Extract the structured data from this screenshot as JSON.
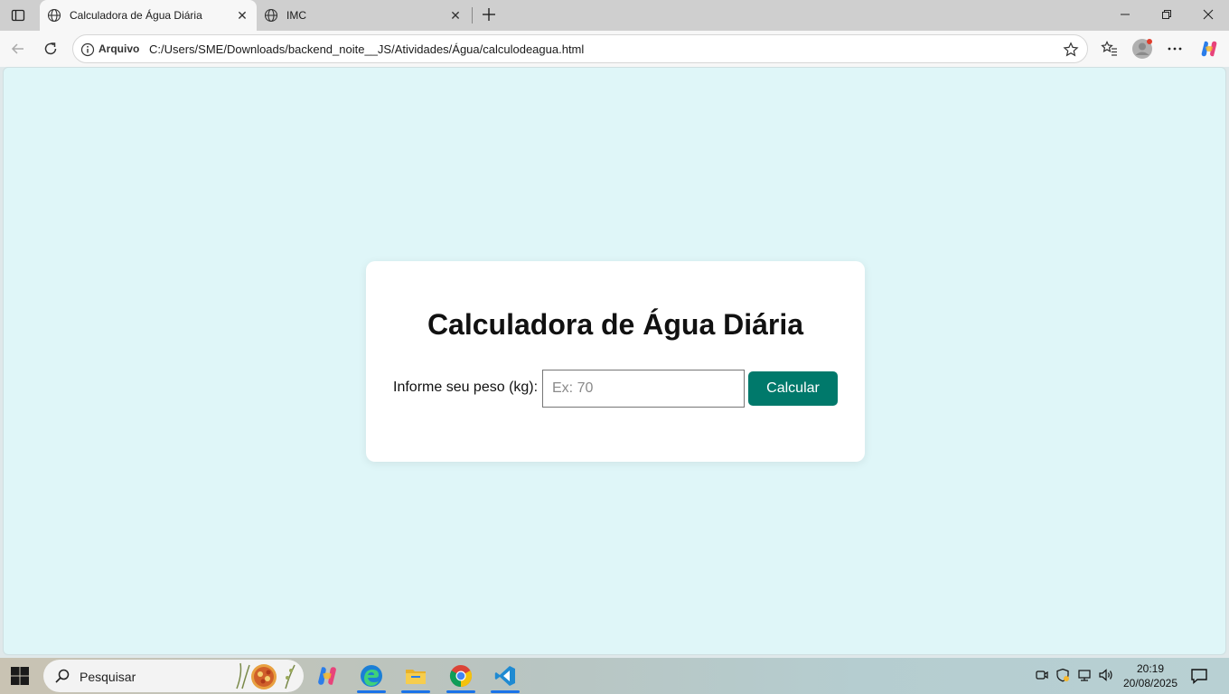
{
  "browser": {
    "tabs": [
      {
        "title": "Calculadora de Água Diária",
        "active": true
      },
      {
        "title": "IMC",
        "active": false
      }
    ],
    "address": {
      "scheme_label": "Arquivo",
      "url": "C:/Users/SME/Downloads/backend_noite__JS/Atividades/Água/calculodeagua.html"
    }
  },
  "page": {
    "background": "#dff6f8",
    "title": "Calculadora de Água Diária",
    "weight_label": "Informe seu peso (kg):",
    "weight_value": "",
    "weight_placeholder": "Ex: 70",
    "calculate_button": "Calcular",
    "button_color": "#00796b"
  },
  "taskbar": {
    "search_placeholder": "Pesquisar",
    "apps": [
      "copilot-icon",
      "edge-icon",
      "file-explorer-icon",
      "chrome-icon",
      "vscode-icon"
    ],
    "time": "20:19",
    "date": "20/08/2025"
  }
}
